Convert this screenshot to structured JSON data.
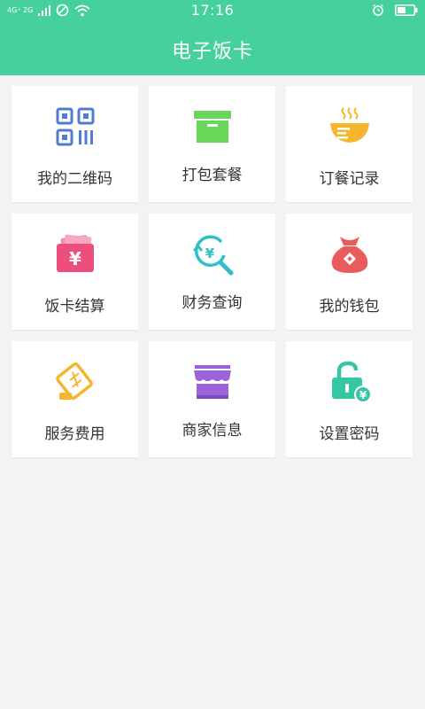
{
  "status": {
    "time": "17:16",
    "signal_text": "4G⁺ 2G",
    "icons": [
      "signal-icon",
      "no-sim-icon",
      "wifi-icon",
      "alarm-icon",
      "battery-icon"
    ]
  },
  "header": {
    "title": "电子饭卡"
  },
  "menu": [
    {
      "label": "我的二维码",
      "icon": "qr-code-icon"
    },
    {
      "label": "打包套餐",
      "icon": "package-box-icon"
    },
    {
      "label": "订餐记录",
      "icon": "bowl-icon"
    },
    {
      "label": "饭卡结算",
      "icon": "yuan-wallet-icon"
    },
    {
      "label": "财务查询",
      "icon": "yuan-search-icon"
    },
    {
      "label": "我的钱包",
      "icon": "money-bag-icon"
    },
    {
      "label": "服务费用",
      "icon": "ticket-icon"
    },
    {
      "label": "商家信息",
      "icon": "storefront-icon"
    },
    {
      "label": "设置密码",
      "icon": "unlock-icon"
    }
  ],
  "colors": {
    "header": "#46d19c",
    "qr": "#4f7bd1",
    "box": "#69d85a",
    "bowl": "#f5b52d",
    "wallet": "#ee4e7c",
    "search": "#2fbfc6",
    "bag": "#ea5b5b",
    "ticket": "#f5b52d",
    "store": "#9b62d9",
    "lock": "#35c7a3"
  }
}
